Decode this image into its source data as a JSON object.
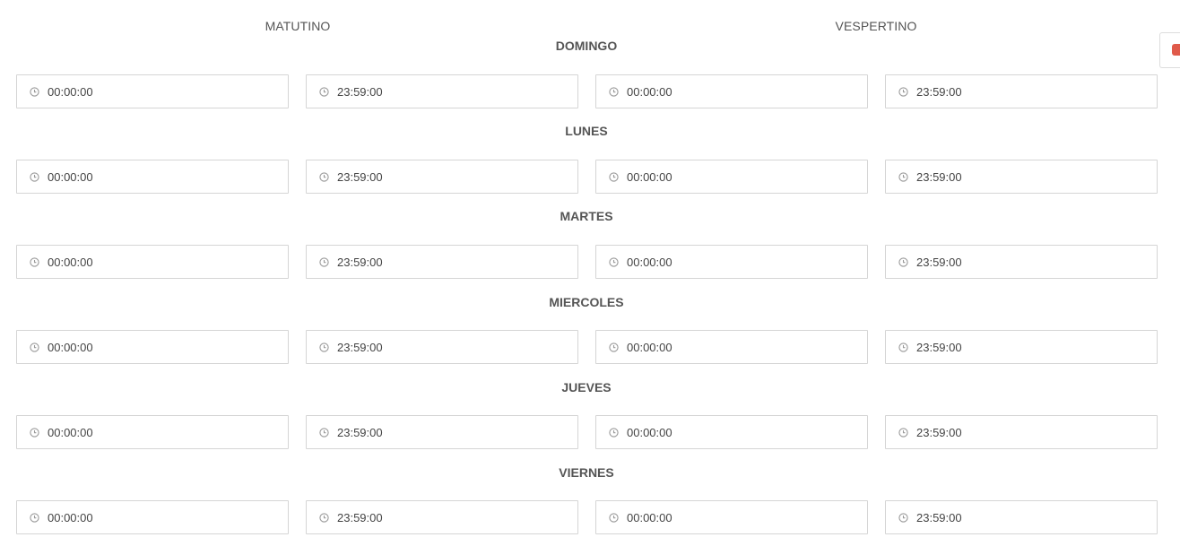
{
  "headers": {
    "morning": "MATUTINO",
    "evening": "VESPERTINO"
  },
  "days": [
    {
      "name": "DOMINGO",
      "times": [
        "00:00:00",
        "23:59:00",
        "00:00:00",
        "23:59:00"
      ]
    },
    {
      "name": "LUNES",
      "times": [
        "00:00:00",
        "23:59:00",
        "00:00:00",
        "23:59:00"
      ]
    },
    {
      "name": "MARTES",
      "times": [
        "00:00:00",
        "23:59:00",
        "00:00:00",
        "23:59:00"
      ]
    },
    {
      "name": "MIERCOLES",
      "times": [
        "00:00:00",
        "23:59:00",
        "00:00:00",
        "23:59:00"
      ]
    },
    {
      "name": "JUEVES",
      "times": [
        "00:00:00",
        "23:59:00",
        "00:00:00",
        "23:59:00"
      ]
    },
    {
      "name": "VIERNES",
      "times": [
        "00:00:00",
        "23:59:00",
        "00:00:00",
        "23:59:00"
      ]
    }
  ],
  "colors": {
    "badge": "#e05a4a",
    "border": "#d5d5d5",
    "text": "#555555"
  },
  "icons": {
    "field": "clock-icon",
    "side_tab": "notification-badge"
  }
}
